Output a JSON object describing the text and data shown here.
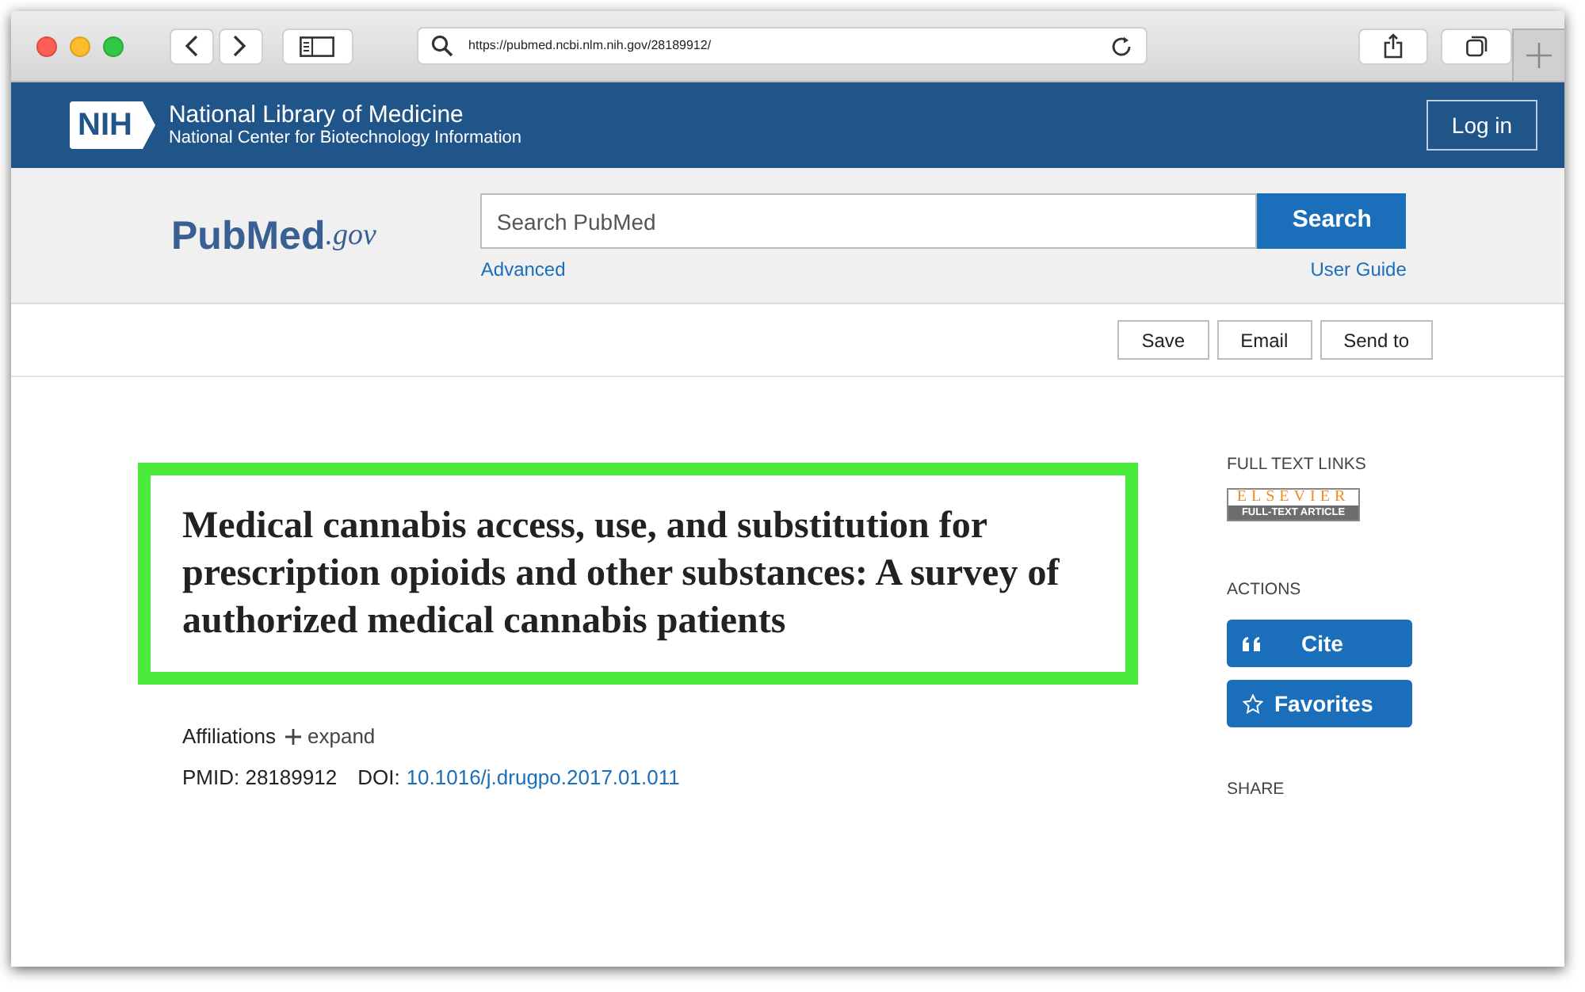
{
  "browser": {
    "url": "https://pubmed.ncbi.nlm.nih.gov/28189912/"
  },
  "header": {
    "logo": "NIH",
    "title": "National Library of Medicine",
    "subtitle": "National Center for Biotechnology Information",
    "login": "Log in"
  },
  "search": {
    "logo_main": "PubMed",
    "logo_suffix": ".gov",
    "placeholder": "Search PubMed",
    "button": "Search",
    "advanced": "Advanced",
    "user_guide": "User Guide"
  },
  "actions": [
    "Save",
    "Email",
    "Send to"
  ],
  "article": {
    "title": "Medical cannabis access, use, and substitution for prescription opioids and other substances: A survey of authorized medical cannabis patients",
    "affiliations": "Affiliations",
    "expand": "expand",
    "pmid": "PMID: 28189912",
    "doi_label": "DOI:",
    "doi": "10.1016/j.drugpo.2017.01.011"
  },
  "sidebar": {
    "full_text_heading": "FULL TEXT LINKS",
    "publisher": "ELSEVIER",
    "publisher_caption": "FULL-TEXT ARTICLE",
    "actions_heading": "ACTIONS",
    "buttons": [
      {
        "kind": "cite",
        "label": "Cite"
      },
      {
        "kind": "favorites",
        "label": "Favorites"
      }
    ],
    "share_heading": "SHARE"
  }
}
